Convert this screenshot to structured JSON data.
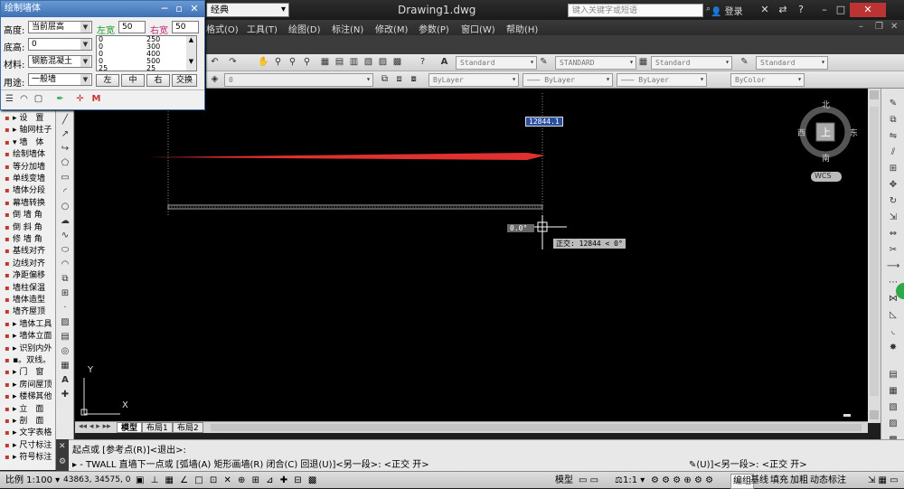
{
  "titlebar": {
    "workspace": "经典",
    "document": "Drawing1.dwg",
    "search_placeholder": "键入关键字或短语",
    "login": "登录"
  },
  "menu": [
    "格式(O)",
    "工具(T)",
    "绘图(D)",
    "标注(N)",
    "修改(M)",
    "参数(P)",
    "窗口(W)",
    "帮助(H)"
  ],
  "toolbar": {
    "text_style": "Standard",
    "dim_style": "STANDARD",
    "table_style": "Standard",
    "mleader_style": "Standard",
    "layer": "0",
    "color": "ByLayer",
    "linetype": "ByLayer",
    "lineweight": "ByLayer",
    "plotstyle": "ByColor"
  },
  "dialog": {
    "title": "绘制墙体",
    "height_label": "高度:",
    "height_value": "当前层高",
    "left_width_label": "左宽",
    "left_width_value": "50",
    "right_width_label": "右宽",
    "right_width_value": "50",
    "base_label": "底高:",
    "base_value": "0",
    "material_label": "材料:",
    "material_value": "钢筋混凝土",
    "use_label": "用途:",
    "use_value": "一般墙",
    "width_list_left": [
      "0",
      "0",
      "0",
      "0",
      "25"
    ],
    "width_list_right": [
      "250",
      "300",
      "400",
      "500",
      "25"
    ],
    "buttons": [
      "左",
      "中",
      "右",
      "交换"
    ]
  },
  "palette": {
    "items": [
      "▸ 设　置",
      "▸ 轴网柱子",
      "▾ 墙　体",
      "绘制墙体",
      "等分加墙",
      "单线变墙",
      "墙体分段",
      "幕墙转换",
      "倒 墙 角",
      "倒 斜 角",
      "修 墙 角",
      "基线对齐",
      "边线对齐",
      "净距偏移",
      "墙柱保温",
      "墙体造型",
      "墙齐屋顶",
      "▸ 墙体工具",
      "▸ 墙体立面",
      "▸ 识别内外",
      "▪。双线。",
      "▸ 门　窗",
      "▸ 房间屋顶",
      "▸ 楼梯其他",
      "▸ 立　面",
      "▸ 剖　面",
      "▸ 文字表格",
      "▸ 尺寸标注",
      "▸ 符号标注"
    ]
  },
  "canvas": {
    "dim_input": "12844.1",
    "angle_input": "0.0°",
    "ortho_tooltip": "正交: 12844 < 0°",
    "compass": {
      "north": "北",
      "south": "南",
      "east": "东",
      "west": "西",
      "top": "上",
      "wcs": "WCS"
    },
    "ucs_x": "X",
    "ucs_y": "Y",
    "arrow_color": "#e03030"
  },
  "tabs": [
    "模型",
    "布局1",
    "布局2"
  ],
  "command": {
    "line1": "起点或 [参考点(R)]<退出>:",
    "line2": "TWALL 直墙下一点或 [弧墙(A) 矩形画墙(R) 闭合(C) 回退(U)]<另一段>: <正交 开>",
    "right_fragment": "(U)]<另一段>: <正交 开>"
  },
  "status": {
    "scale": "比例 1:100",
    "coords": "43863, 34575, 0",
    "model": "模型",
    "annotation_scale": "1:1",
    "toggles": [
      "编组",
      "基线",
      "填充",
      "加粗",
      "动态标注"
    ]
  }
}
